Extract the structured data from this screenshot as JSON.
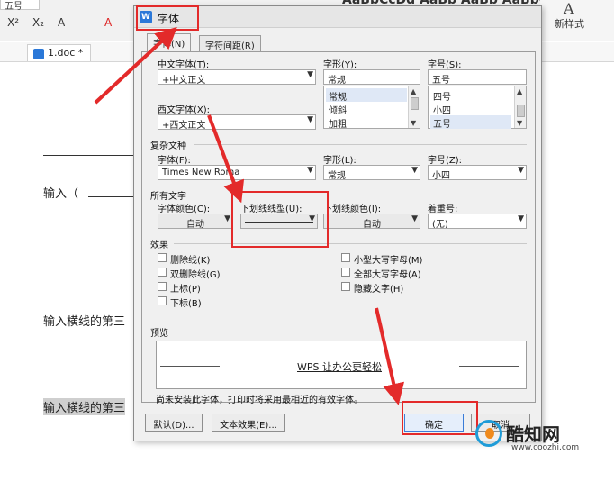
{
  "background": {
    "ribbon": {
      "font_size_value": "五号",
      "format_buttons": [
        "X²",
        "X₂",
        "A",
        "A"
      ],
      "style_gallery": "AaBbCcDd  AaBb  AaBb  AaBbC",
      "styles_label": "新样式",
      "styles_icon": "A"
    },
    "document_tab": "1.doc *",
    "document": {
      "line1": "输入（",
      "line2": "输入横线的第三",
      "line3": "输入横线的第三"
    }
  },
  "dialog": {
    "title": "字体",
    "app_icon": "W",
    "tabs": [
      {
        "label": "字体(N)",
        "active": true
      },
      {
        "label": "字符间距(R)",
        "active": false
      }
    ],
    "chinese_font": {
      "label": "中文字体(T):",
      "value": "+中文正文"
    },
    "western_font": {
      "label": "西文字体(X):",
      "value": "+西文正文"
    },
    "font_style": {
      "label": "字形(Y):",
      "value": "常规",
      "options": [
        "常规",
        "倾斜",
        "加粗"
      ],
      "selected": "常规"
    },
    "font_size": {
      "label": "字号(S):",
      "value": "五号",
      "options": [
        "四号",
        "小四",
        "五号"
      ],
      "selected": "五号"
    },
    "complex_script": {
      "section_label": "复杂文种",
      "font_label": "字体(F):",
      "font_value": "Times New Roma",
      "style_label": "字形(L):",
      "style_value": "常规",
      "size_label": "字号(Z):",
      "size_value": "小四"
    },
    "all_text": {
      "section_label": "所有文字",
      "font_color_label": "字体颜色(C):",
      "font_color_value": "自动",
      "underline_type_label": "下划线线型(U):",
      "underline_color_label": "下划线颜色(I):",
      "underline_color_value": "自动",
      "emphasis_label": "着重号:",
      "emphasis_value": "(无)"
    },
    "effects": {
      "section_label": "效果",
      "left": [
        "删除线(K)",
        "双删除线(G)",
        "上标(P)",
        "下标(B)"
      ],
      "right": [
        "小型大写字母(M)",
        "全部大写字母(A)",
        "隐藏文字(H)"
      ]
    },
    "preview": {
      "section_label": "预览",
      "sample_text": "WPS 让办公更轻松",
      "note": "尚未安装此字体，打印时将采用最相近的有效字体。"
    },
    "buttons": {
      "default": "默认(D)...",
      "text_effects": "文本效果(E)...",
      "ok": "确定",
      "cancel": "取消"
    }
  },
  "annotation_color": "#e32a2a",
  "watermark": {
    "name": "酷知网",
    "url": "www.coozhi.com"
  }
}
